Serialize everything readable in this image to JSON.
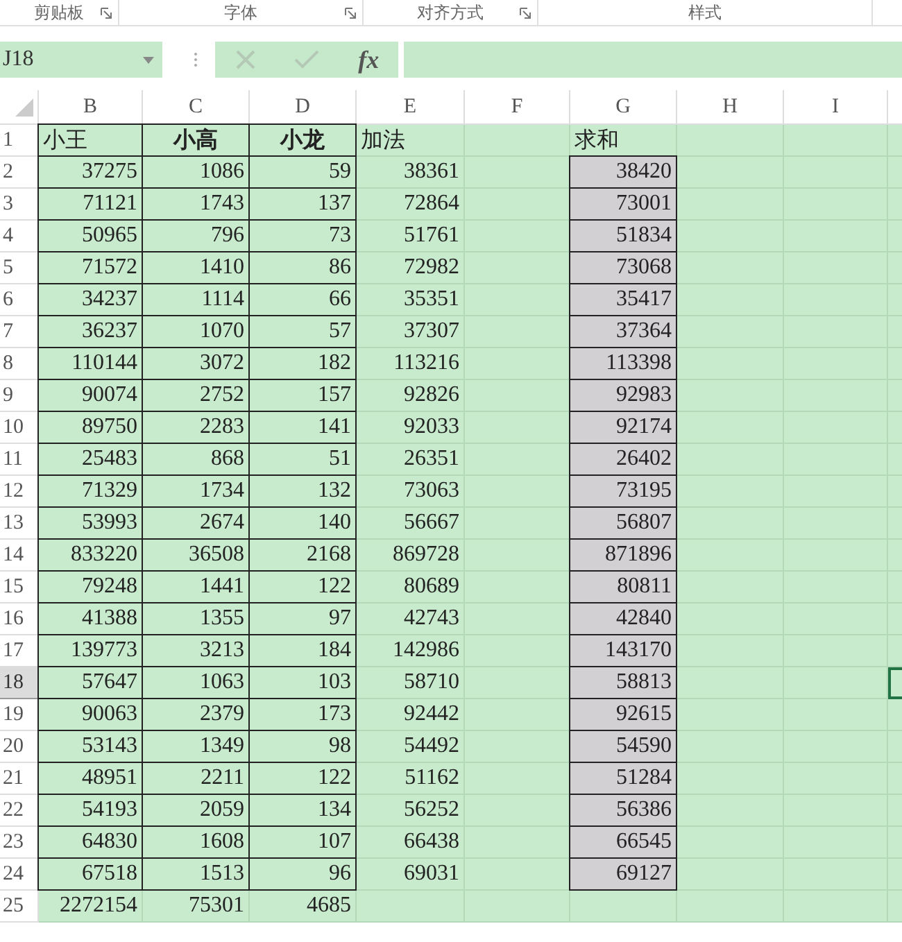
{
  "ribbon_groups": [
    {
      "label": "剪贴板",
      "launcher": true
    },
    {
      "label": "字体",
      "launcher": true
    },
    {
      "label": "对齐方式",
      "launcher": true
    },
    {
      "label": "样式",
      "launcher": false
    }
  ],
  "formula_bar": {
    "name_box": "J18",
    "fx": "fx"
  },
  "columns": [
    "B",
    "C",
    "D",
    "E",
    "F",
    "G",
    "H",
    "I"
  ],
  "rows": [
    {
      "number": "1",
      "kind": "header",
      "selected": false,
      "bold": {
        "B": false,
        "C": true,
        "D": true,
        "E": false,
        "G": false
      },
      "cells": {
        "B": "小王",
        "C": "小高",
        "D": "小龙",
        "E": "加法",
        "G": "求和"
      }
    },
    {
      "number": "2",
      "kind": "data",
      "selected": false,
      "cells": {
        "B": "37275",
        "C": "1086",
        "D": "59",
        "E": "38361",
        "G": "38420"
      }
    },
    {
      "number": "3",
      "kind": "data",
      "selected": false,
      "cells": {
        "B": "71121",
        "C": "1743",
        "D": "137",
        "E": "72864",
        "G": "73001"
      }
    },
    {
      "number": "4",
      "kind": "data",
      "selected": false,
      "cells": {
        "B": "50965",
        "C": "796",
        "D": "73",
        "E": "51761",
        "G": "51834"
      }
    },
    {
      "number": "5",
      "kind": "data",
      "selected": false,
      "cells": {
        "B": "71572",
        "C": "1410",
        "D": "86",
        "E": "72982",
        "G": "73068"
      }
    },
    {
      "number": "6",
      "kind": "data",
      "selected": false,
      "cells": {
        "B": "34237",
        "C": "1114",
        "D": "66",
        "E": "35351",
        "G": "35417"
      }
    },
    {
      "number": "7",
      "kind": "data",
      "selected": false,
      "cells": {
        "B": "36237",
        "C": "1070",
        "D": "57",
        "E": "37307",
        "G": "37364"
      }
    },
    {
      "number": "8",
      "kind": "data",
      "selected": false,
      "cells": {
        "B": "110144",
        "C": "3072",
        "D": "182",
        "E": "113216",
        "G": "113398"
      }
    },
    {
      "number": "9",
      "kind": "data",
      "selected": false,
      "cells": {
        "B": "90074",
        "C": "2752",
        "D": "157",
        "E": "92826",
        "G": "92983"
      }
    },
    {
      "number": "10",
      "kind": "data",
      "selected": false,
      "cells": {
        "B": "89750",
        "C": "2283",
        "D": "141",
        "E": "92033",
        "G": "92174"
      }
    },
    {
      "number": "11",
      "kind": "data",
      "selected": false,
      "cells": {
        "B": "25483",
        "C": "868",
        "D": "51",
        "E": "26351",
        "G": "26402"
      }
    },
    {
      "number": "12",
      "kind": "data",
      "selected": false,
      "cells": {
        "B": "71329",
        "C": "1734",
        "D": "132",
        "E": "73063",
        "G": "73195"
      }
    },
    {
      "number": "13",
      "kind": "data",
      "selected": false,
      "cells": {
        "B": "53993",
        "C": "2674",
        "D": "140",
        "E": "56667",
        "G": "56807"
      }
    },
    {
      "number": "14",
      "kind": "data",
      "selected": false,
      "cells": {
        "B": "833220",
        "C": "36508",
        "D": "2168",
        "E": "869728",
        "G": "871896"
      }
    },
    {
      "number": "15",
      "kind": "data",
      "selected": false,
      "cells": {
        "B": "79248",
        "C": "1441",
        "D": "122",
        "E": "80689",
        "G": "80811"
      }
    },
    {
      "number": "16",
      "kind": "data",
      "selected": false,
      "cells": {
        "B": "41388",
        "C": "1355",
        "D": "97",
        "E": "42743",
        "G": "42840"
      }
    },
    {
      "number": "17",
      "kind": "data",
      "selected": false,
      "cells": {
        "B": "139773",
        "C": "3213",
        "D": "184",
        "E": "142986",
        "G": "143170"
      }
    },
    {
      "number": "18",
      "kind": "data",
      "selected": true,
      "cells": {
        "B": "57647",
        "C": "1063",
        "D": "103",
        "E": "58710",
        "G": "58813"
      }
    },
    {
      "number": "19",
      "kind": "data",
      "selected": false,
      "cells": {
        "B": "90063",
        "C": "2379",
        "D": "173",
        "E": "92442",
        "G": "92615"
      }
    },
    {
      "number": "20",
      "kind": "data",
      "selected": false,
      "cells": {
        "B": "53143",
        "C": "1349",
        "D": "98",
        "E": "54492",
        "G": "54590"
      }
    },
    {
      "number": "21",
      "kind": "data",
      "selected": false,
      "cells": {
        "B": "48951",
        "C": "2211",
        "D": "122",
        "E": "51162",
        "G": "51284"
      }
    },
    {
      "number": "22",
      "kind": "data",
      "selected": false,
      "cells": {
        "B": "54193",
        "C": "2059",
        "D": "134",
        "E": "56252",
        "G": "56386"
      }
    },
    {
      "number": "23",
      "kind": "data",
      "selected": false,
      "cells": {
        "B": "64830",
        "C": "1608",
        "D": "107",
        "E": "66438",
        "G": "66545"
      }
    },
    {
      "number": "24",
      "kind": "data",
      "selected": false,
      "cells": {
        "B": "67518",
        "C": "1513",
        "D": "96",
        "E": "69031",
        "G": "69127"
      }
    },
    {
      "number": "25",
      "kind": "total",
      "selected": false,
      "cells": {
        "B": "2272154",
        "C": "75301",
        "D": "4685"
      }
    }
  ]
}
